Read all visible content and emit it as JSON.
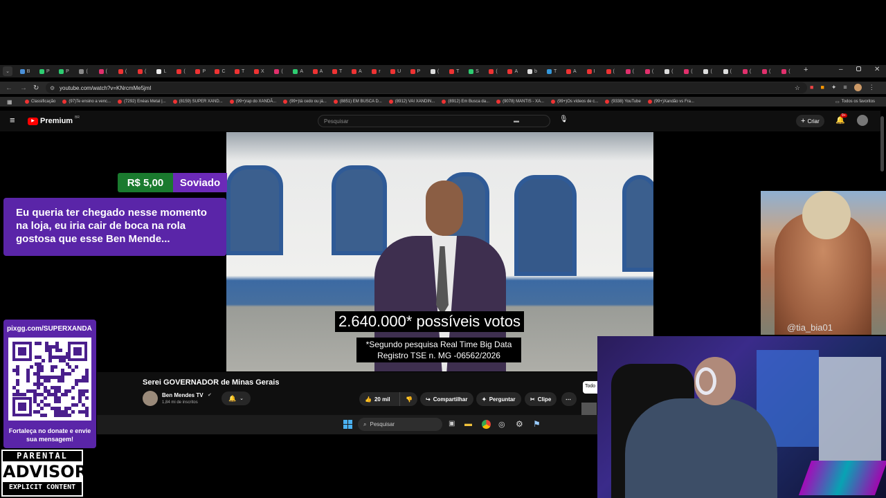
{
  "browser": {
    "tab_labels": [
      "B",
      "P",
      "P",
      "(",
      "(",
      "(",
      "(",
      "L",
      "(",
      "P",
      "C",
      "T",
      "X",
      "(",
      "A",
      "A",
      "T",
      "A",
      "r",
      "U",
      "P",
      "(",
      "T",
      "S",
      "(",
      "A",
      "b",
      "T",
      "A",
      "I",
      "(",
      "(",
      "(",
      "(",
      "(",
      "(",
      "(",
      "(",
      "(",
      "("
    ],
    "url": "youtube.com/watch?v=KNrcmMe5jmI",
    "bookmarks": [
      "Classificação",
      "(97)Te ensino a venc...",
      "(7292) Enéas Metal |...",
      "(8159) SUPER XAND...",
      "(99+)rap do XANDÃ...",
      "(99+)tá cedo ou já...",
      "(8851) EM BUSCA D...",
      "(8912) VAI XANDIN...",
      "(8912) Em Busca da...",
      "(9078) MANTIS - XA...",
      "(99+)Os vídeos de c...",
      "(9338) YouTube",
      "(99+)Xandão vs Fra..."
    ],
    "all_bookmarks": "Todos os favoritos"
  },
  "youtube": {
    "logo": "Premium",
    "logo_badge": "BR",
    "search_placeholder": "Pesquisar",
    "create_label": "Criar",
    "notif_count": "9+",
    "video_title": "Serei GOVERNADOR de Minas Gerais",
    "channel_name": "Ben Mendes TV",
    "subscribers": "1,84 mi de inscritos",
    "likes": "20 mil",
    "share_label": "Compartilhar",
    "ask_label": "Perguntar",
    "clip_label": "Clipe",
    "side_chip": "Todo",
    "caption_main": "2.640.000* possíveis votos",
    "caption_note_1": "*Segundo pesquisa Real Time Big Data",
    "caption_note_2": "Registro TSE n. MG -06562/2026"
  },
  "taskbar": {
    "search_label": "Pesquisar"
  },
  "donation": {
    "amount": "R$ 5,00",
    "donor": "Soviado",
    "message": "Eu queria ter chegado nesse momento na loja, eu iria cair de boca na rola gostosa que esse Ben Mende..."
  },
  "pix": {
    "url": "pixgg.com/SUPERXANDÃ",
    "cta": "Fortaleça no donate e envie sua mensagem!"
  },
  "parental_advisory": {
    "top": "PARENTAL",
    "middle": "ADVISORY",
    "bottom": "EXPLICIT CONTENT"
  },
  "meme": {
    "watermark": "@tia_bia01"
  },
  "colors": {
    "donation_green": "#1a7a2e",
    "donation_purple": "#6c2ab8",
    "youtube_red": "#ff0000"
  }
}
